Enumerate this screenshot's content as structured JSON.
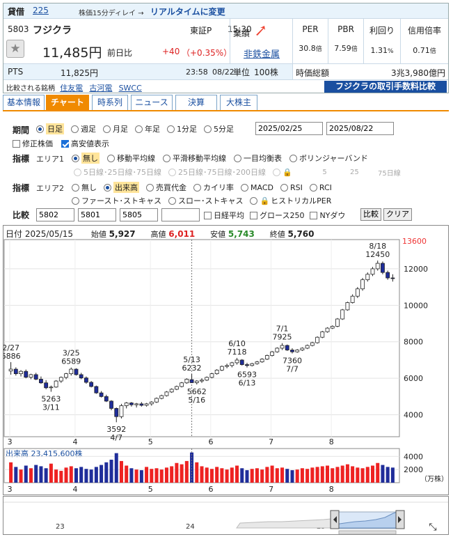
{
  "header": {
    "tag": "貸借",
    "tag_value": "225",
    "delay_note": "株価15分ディレイ →",
    "realtime_link": "リアルタイムに変更",
    "code": "5803",
    "name": "フジクラ",
    "market": "東証P",
    "time": "15:30",
    "price": "11,485円",
    "change_label": "前日比",
    "change": "+40",
    "change_pct": "（+0.35%）",
    "pts_label": "PTS",
    "pts_price": "11,825円",
    "pts_time": "23:58",
    "pts_date": "08/22",
    "compare_label": "比較される銘柄",
    "compare_items": [
      "住友電",
      "古河電",
      "SWCC"
    ],
    "industry_label": "業績",
    "industry_value": "非鉄金属",
    "unit_label": "単位",
    "unit_value": "100株",
    "metrics": [
      {
        "label": "PER",
        "value": "30.8",
        "unit": "倍"
      },
      {
        "label": "PBR",
        "value": "7.59",
        "unit": "倍"
      },
      {
        "label": "利回り",
        "value": "1.31",
        "unit": "%"
      },
      {
        "label": "信用倍率",
        "value": "0.71",
        "unit": "倍"
      }
    ],
    "mcap_label": "時価総額",
    "mcap_value": "3兆3,980億円",
    "fee_button": "フジクラの取引手数料比較"
  },
  "tabs": [
    "基本情報",
    "チャート",
    "時系列",
    "ニュース",
    "決算",
    "大株主"
  ],
  "active_tab": 1,
  "controls": {
    "period_label": "期間",
    "periods": [
      "日足",
      "週足",
      "月足",
      "年足",
      "1分足",
      "5分足"
    ],
    "date_from": "2025/02/25",
    "date_to": "2025/08/22",
    "adjusted_label": "修正株価",
    "highlow_label": "高安値表示",
    "indicator_label": "指標",
    "area1_label": "エリア1",
    "area1_options": [
      "無し",
      "移動平均線",
      "平滑移動平均線",
      "一目均衡表",
      "ボリンジャーバンド"
    ],
    "ma_options": [
      "5日線･25日線･75日線",
      "25日線･75日線･200日線"
    ],
    "ma_values": [
      "5",
      "25",
      "75日線"
    ],
    "area2_label": "エリア2",
    "area2_options": [
      "無し",
      "出来高",
      "売買代金",
      "カイリ率",
      "MACD",
      "RSI",
      "RCI"
    ],
    "area2_options_b": [
      "ファースト･ストキャス",
      "スロー･ストキャス",
      "ヒストリカルPER"
    ],
    "compare_label": "比較",
    "compare_inputs": [
      "5802",
      "5801",
      "5805",
      ""
    ],
    "compare_checks": [
      "日経平均",
      "グロース250",
      "NYダウ"
    ],
    "compare_button": "比較",
    "clear_button": "クリア"
  },
  "chart_info": {
    "date_label": "日付",
    "date": "2025/05/15",
    "open_label": "始値",
    "open": "5,927",
    "high_label": "高値",
    "high": "6,011",
    "low_label": "安値",
    "low": "5,743",
    "close_label": "終値",
    "close": "5,760"
  },
  "chart_data": {
    "type": "candlestick",
    "y_ticks": [
      4000,
      6000,
      8000,
      10000,
      12000
    ],
    "y_top_label": "13600",
    "ylim": [
      2800,
      13600
    ],
    "x_ticks": [
      "3",
      "4",
      "5",
      "6",
      "7",
      "8"
    ],
    "annotations": [
      {
        "lines": [
          "2/27",
          "6886"
        ]
      },
      {
        "lines": [
          "5263",
          "3/11"
        ]
      },
      {
        "lines": [
          "3/25",
          "6589"
        ]
      },
      {
        "lines": [
          "3592",
          "4/7"
        ]
      },
      {
        "lines": [
          "5/13",
          "6232"
        ]
      },
      {
        "lines": [
          "5662",
          "5/16"
        ]
      },
      {
        "lines": [
          "6/10",
          "7118"
        ]
      },
      {
        "lines": [
          "6593",
          "6/13"
        ]
      },
      {
        "lines": [
          "7/1",
          "7925"
        ]
      },
      {
        "lines": [
          "7360",
          "7/7"
        ]
      },
      {
        "lines": [
          "8/18",
          "12450"
        ]
      }
    ],
    "candles": [
      [
        6400,
        6886,
        6200,
        6500
      ],
      [
        6500,
        6600,
        6150,
        6250
      ],
      [
        6250,
        6450,
        6100,
        6380
      ],
      [
        6380,
        6480,
        6000,
        6060
      ],
      [
        6060,
        6250,
        5950,
        6200
      ],
      [
        6200,
        6300,
        5900,
        5950
      ],
      [
        5950,
        6100,
        5700,
        5750
      ],
      [
        5750,
        5900,
        5400,
        5480
      ],
      [
        5480,
        5600,
        5263,
        5520
      ],
      [
        5520,
        5900,
        5480,
        5850
      ],
      [
        5850,
        6100,
        5750,
        6050
      ],
      [
        6050,
        6300,
        5950,
        6250
      ],
      [
        6250,
        6589,
        6150,
        6500
      ],
      [
        6500,
        6550,
        6150,
        6200
      ],
      [
        6200,
        6300,
        5950,
        6020
      ],
      [
        6020,
        6100,
        5700,
        5780
      ],
      [
        5780,
        5850,
        5500,
        5550
      ],
      [
        5550,
        5600,
        5150,
        5200
      ],
      [
        5200,
        5300,
        4950,
        5000
      ],
      [
        5000,
        5100,
        4700,
        4750
      ],
      [
        4750,
        4800,
        4250,
        4350
      ],
      [
        4350,
        4400,
        3592,
        3900
      ],
      [
        3900,
        4600,
        3800,
        4500
      ],
      [
        4500,
        4700,
        4350,
        4650
      ],
      [
        4650,
        4700,
        4450,
        4550
      ],
      [
        4550,
        4650,
        4400,
        4600
      ],
      [
        4600,
        4700,
        4450,
        4520
      ],
      [
        4520,
        4650,
        4450,
        4600
      ],
      [
        4600,
        4750,
        4500,
        4700
      ],
      [
        4700,
        4950,
        4650,
        4900
      ],
      [
        4900,
        5100,
        4850,
        5050
      ],
      [
        5050,
        5300,
        5000,
        5250
      ],
      [
        5250,
        5450,
        5200,
        5400
      ],
      [
        5400,
        5600,
        5350,
        5550
      ],
      [
        5550,
        5800,
        5500,
        5750
      ],
      [
        5750,
        6000,
        5700,
        5950
      ],
      [
        5927,
        6232,
        5743,
        5760
      ],
      [
        5760,
        5900,
        5662,
        5850
      ],
      [
        5850,
        6000,
        5750,
        5900
      ],
      [
        5900,
        6100,
        5850,
        6050
      ],
      [
        6050,
        6300,
        6000,
        6250
      ],
      [
        6250,
        6500,
        6200,
        6450
      ],
      [
        6450,
        6700,
        6400,
        6650
      ],
      [
        6650,
        6800,
        6550,
        6700
      ],
      [
        6700,
        6900,
        6600,
        6850
      ],
      [
        6850,
        7118,
        6750,
        7000
      ],
      [
        7000,
        7050,
        6700,
        6750
      ],
      [
        6750,
        6850,
        6593,
        6700
      ],
      [
        6700,
        6850,
        6650,
        6800
      ],
      [
        6800,
        6950,
        6750,
        6900
      ],
      [
        6900,
        7100,
        6850,
        7050
      ],
      [
        7050,
        7300,
        7000,
        7250
      ],
      [
        7250,
        7500,
        7200,
        7450
      ],
      [
        7450,
        7700,
        7400,
        7650
      ],
      [
        7650,
        7925,
        7550,
        7800
      ],
      [
        7800,
        7850,
        7500,
        7550
      ],
      [
        7550,
        7650,
        7360,
        7450
      ],
      [
        7450,
        7600,
        7400,
        7550
      ],
      [
        7550,
        7700,
        7500,
        7650
      ],
      [
        7650,
        7850,
        7600,
        7800
      ],
      [
        7800,
        8000,
        7750,
        7950
      ],
      [
        7950,
        8300,
        7900,
        8250
      ],
      [
        8250,
        8600,
        8200,
        8550
      ],
      [
        8550,
        8800,
        8500,
        8750
      ],
      [
        8750,
        8900,
        8700,
        8850
      ],
      [
        8850,
        9300,
        8800,
        9250
      ],
      [
        9250,
        9800,
        9200,
        9750
      ],
      [
        9750,
        10200,
        9700,
        10150
      ],
      [
        10150,
        10600,
        10100,
        10500
      ],
      [
        10500,
        11000,
        10400,
        10900
      ],
      [
        10900,
        11500,
        10800,
        11400
      ],
      [
        11400,
        11800,
        11300,
        11700
      ],
      [
        11700,
        12100,
        11600,
        12000
      ],
      [
        12000,
        12450,
        11900,
        12300
      ],
      [
        12300,
        12400,
        11700,
        11800
      ],
      [
        11800,
        11900,
        11400,
        11500
      ],
      [
        11500,
        11700,
        11300,
        11485
      ]
    ]
  },
  "volume_panel": {
    "label": "出来高",
    "value": "23,415,600株",
    "y_ticks": [
      2000,
      4000
    ],
    "unit": "（万株）",
    "x_ticks": [
      "3",
      "4",
      "5",
      "6",
      "7",
      "8"
    ],
    "volumes": [
      3100,
      2400,
      2000,
      2600,
      2200,
      2700,
      2500,
      2200,
      2900,
      2000,
      1800,
      2300,
      2500,
      2200,
      2400,
      2100,
      2000,
      2400,
      2700,
      3100,
      3500,
      4500,
      3300,
      2600,
      2200,
      2000,
      1900,
      2400,
      2100,
      2200,
      2000,
      2300,
      2500,
      3000,
      2800,
      3300,
      4600,
      3100,
      2500,
      2300,
      2100,
      2400,
      2200,
      2000,
      2300,
      2600,
      2200,
      1900,
      2100,
      2200,
      2000,
      2400,
      2600,
      2200,
      2300,
      2100,
      1900,
      2000,
      2200,
      2100,
      2300,
      2400,
      2500,
      2600,
      2200,
      2400,
      2600,
      2800,
      2500,
      2300,
      2200,
      2400,
      2600,
      3000,
      2700,
      2400,
      2300
    ]
  },
  "navigator": {
    "ticks": [
      "23",
      "24",
      "25"
    ]
  },
  "colors": {
    "accent": "#f08a00",
    "link": "#1a4fa0",
    "up": "#d22",
    "down_candle": "#1f2d9a",
    "low_color": "#2a8a2a"
  }
}
